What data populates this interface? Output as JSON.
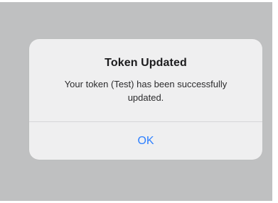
{
  "alert": {
    "title": "Token Updated",
    "message": "Your token (Test) has been successfully updated.",
    "ok_label": "OK"
  },
  "colors": {
    "backdrop": "#bfc0c1",
    "dialog": "#efeff0",
    "accent": "#2f80ff"
  }
}
